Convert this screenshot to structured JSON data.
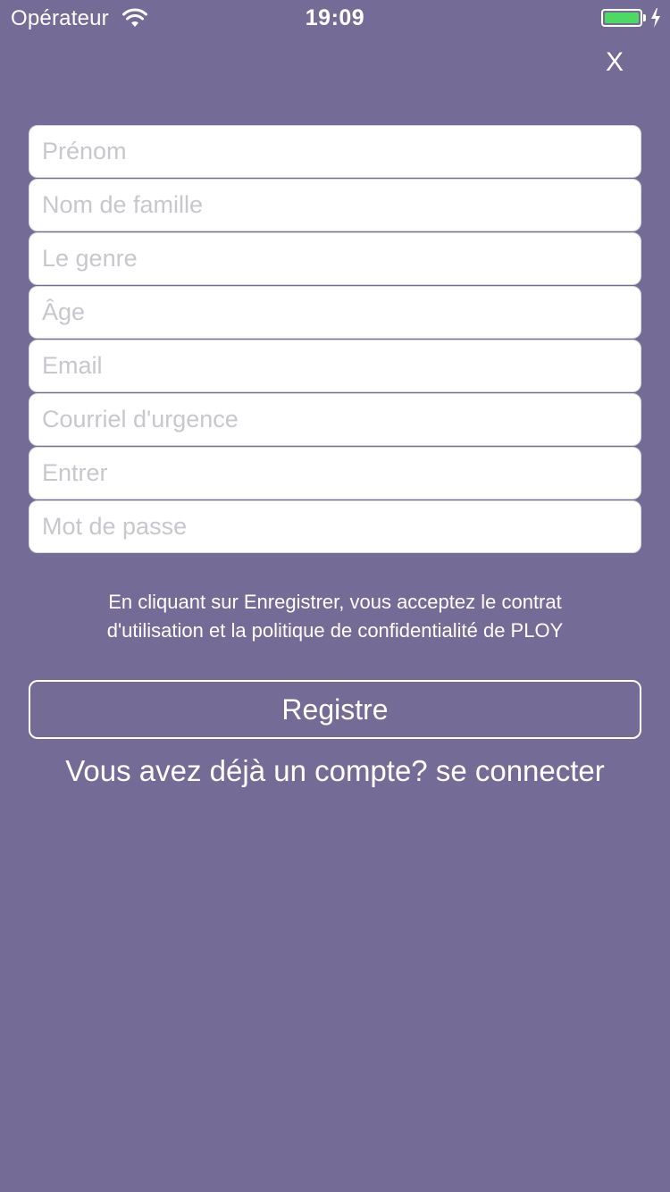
{
  "status_bar": {
    "carrier": "Opérateur",
    "time": "19:09",
    "battery_level": 1.0,
    "battery_color": "#4cd964",
    "wifi_icon": "wifi-icon",
    "charging_icon": "bolt-icon"
  },
  "header": {
    "close_label": "X"
  },
  "form": {
    "fields": [
      {
        "placeholder": "Prénom",
        "value": ""
      },
      {
        "placeholder": "Nom de famille",
        "value": ""
      },
      {
        "placeholder": "Le genre",
        "value": ""
      },
      {
        "placeholder": "Âge",
        "value": ""
      },
      {
        "placeholder": "Email",
        "value": ""
      },
      {
        "placeholder": "Courriel d'urgence",
        "value": ""
      },
      {
        "placeholder": "Entrer",
        "value": ""
      },
      {
        "placeholder": "Mot de passe",
        "value": ""
      }
    ]
  },
  "terms": {
    "line1": "En cliquant sur Enregistrer, vous acceptez le contrat",
    "line2": "d'utilisation et la politique de confidentialité de PLOY"
  },
  "actions": {
    "register_label": "Registre",
    "login_link": "Vous avez déjà un compte? se connecter"
  },
  "colors": {
    "background": "#746c96",
    "field_background": "#ffffff",
    "placeholder": "#c7c7cd",
    "text": "#ffffff"
  }
}
